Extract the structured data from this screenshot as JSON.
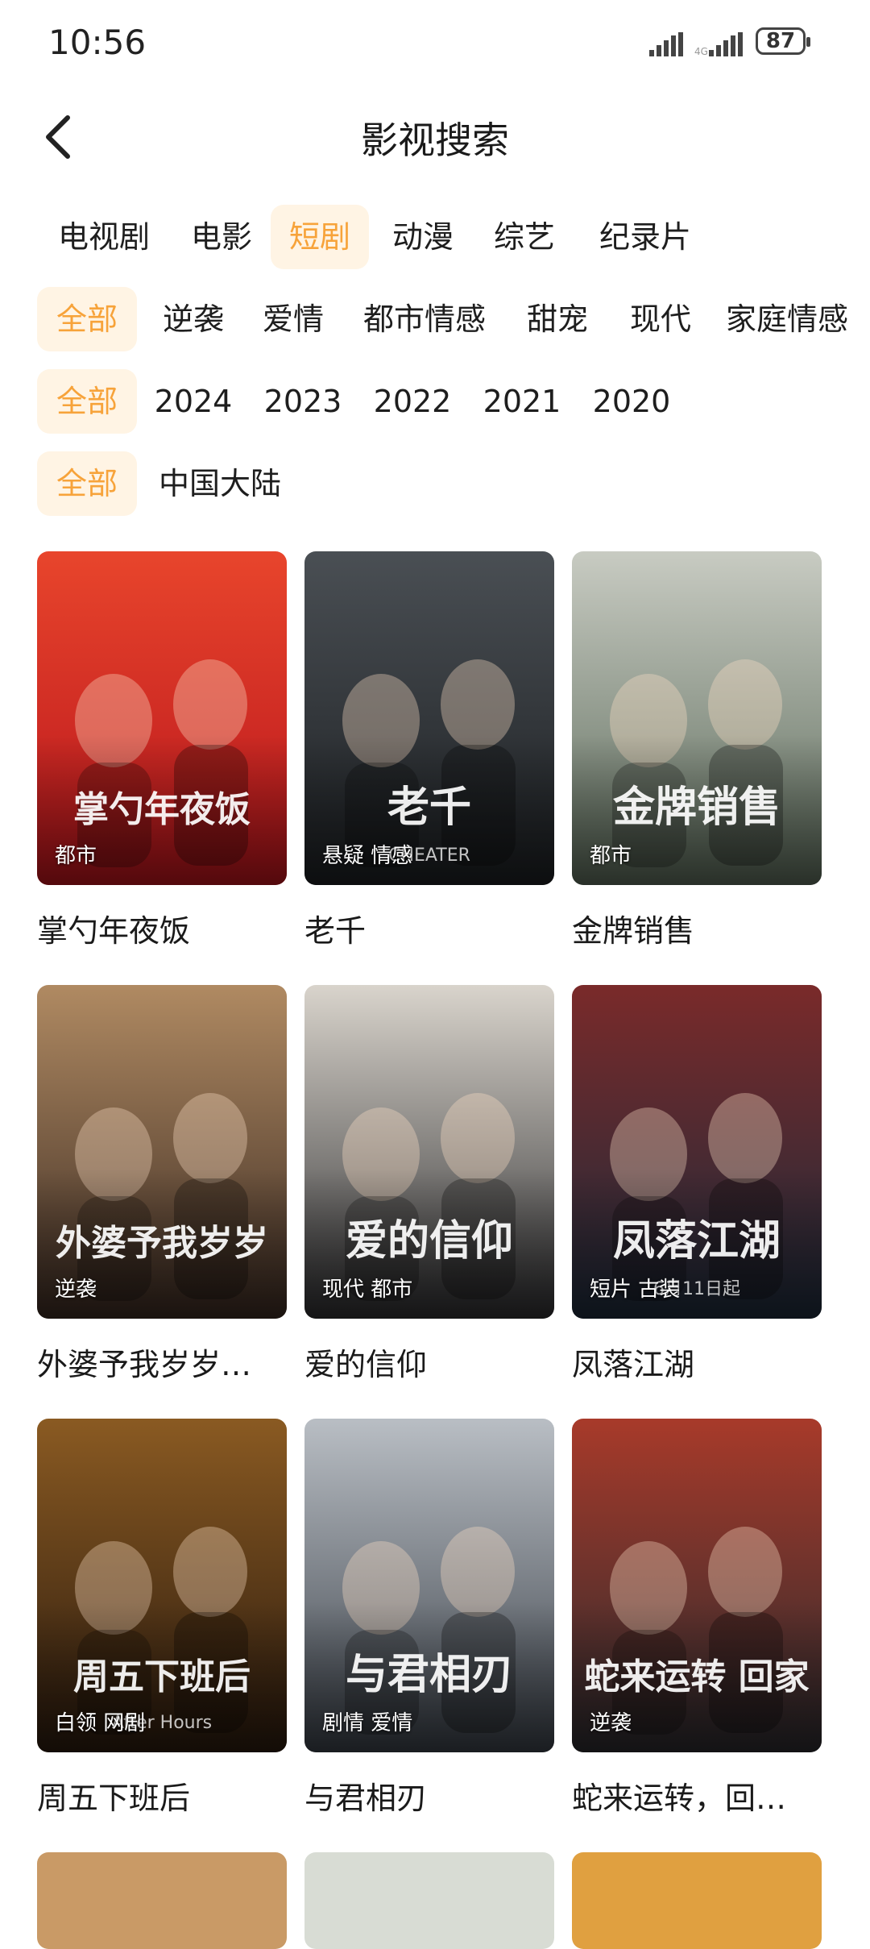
{
  "status": {
    "time": "10:56",
    "battery": "87"
  },
  "header": {
    "title": "影视搜索"
  },
  "categories": [
    {
      "label": "电视剧",
      "active": false
    },
    {
      "label": "电影",
      "active": false
    },
    {
      "label": "短剧",
      "active": true
    },
    {
      "label": "动漫",
      "active": false
    },
    {
      "label": "综艺",
      "active": false
    },
    {
      "label": "纪录片",
      "active": false
    }
  ],
  "genres": [
    {
      "label": "全部",
      "active": true
    },
    {
      "label": "逆袭",
      "active": false
    },
    {
      "label": "爱情",
      "active": false
    },
    {
      "label": "都市情感",
      "active": false
    },
    {
      "label": "甜宠",
      "active": false
    },
    {
      "label": "现代",
      "active": false
    },
    {
      "label": "家庭情感",
      "active": false
    }
  ],
  "years": [
    {
      "label": "全部",
      "active": true
    },
    {
      "label": "2024",
      "active": false
    },
    {
      "label": "2023",
      "active": false
    },
    {
      "label": "2022",
      "active": false
    },
    {
      "label": "2021",
      "active": false
    },
    {
      "label": "2020",
      "active": false
    }
  ],
  "regions": [
    {
      "label": "全部",
      "active": true
    },
    {
      "label": "中国大陆",
      "active": false
    }
  ],
  "results": [
    {
      "title": "掌勺年夜饭",
      "tags": "都市",
      "poster_text": "掌勺年夜饭",
      "colors": [
        "#b8141c",
        "#e8452c"
      ]
    },
    {
      "title": "老千",
      "tags": "悬疑 情感",
      "poster_text": "老千",
      "subtext": "CHEATER",
      "colors": [
        "#1c1f22",
        "#4a4f54"
      ]
    },
    {
      "title": "金牌销售",
      "tags": "都市",
      "poster_text": "金牌销售",
      "colors": [
        "#5b6a5a",
        "#c8cbc2"
      ]
    },
    {
      "title": "外婆予我岁岁…",
      "tags": "逆袭",
      "poster_text": "外婆予我岁岁",
      "colors": [
        "#3a2a22",
        "#b08a62"
      ]
    },
    {
      "title": "爱的信仰",
      "tags": "现代 都市",
      "poster_text": "爱的信仰",
      "colors": [
        "#2e2e30",
        "#d9d4cc"
      ]
    },
    {
      "title": "凤落江湖",
      "tags": "短片 古装",
      "poster_text": "凤落江湖",
      "subtext": "6月11日起",
      "colors": [
        "#1c2a3a",
        "#7a2a2a"
      ]
    },
    {
      "title": "周五下班后",
      "tags": "白领 网剧",
      "poster_text": "周五下班后",
      "subtext": "After Hours",
      "colors": [
        "#2a1a0e",
        "#8a5a22"
      ]
    },
    {
      "title": "与君相刃",
      "tags": "剧情 爱情",
      "poster_text": "与君相刃",
      "colors": [
        "#3a4048",
        "#b9bec4"
      ]
    },
    {
      "title": "蛇来运转，回…",
      "tags": "逆袭",
      "poster_text": "蛇来运转 回家",
      "colors": [
        "#2a2a2e",
        "#a83a2a"
      ]
    }
  ],
  "icons": {
    "back": "chevron-left-icon",
    "signal": "signal-icon",
    "battery": "battery-icon"
  }
}
